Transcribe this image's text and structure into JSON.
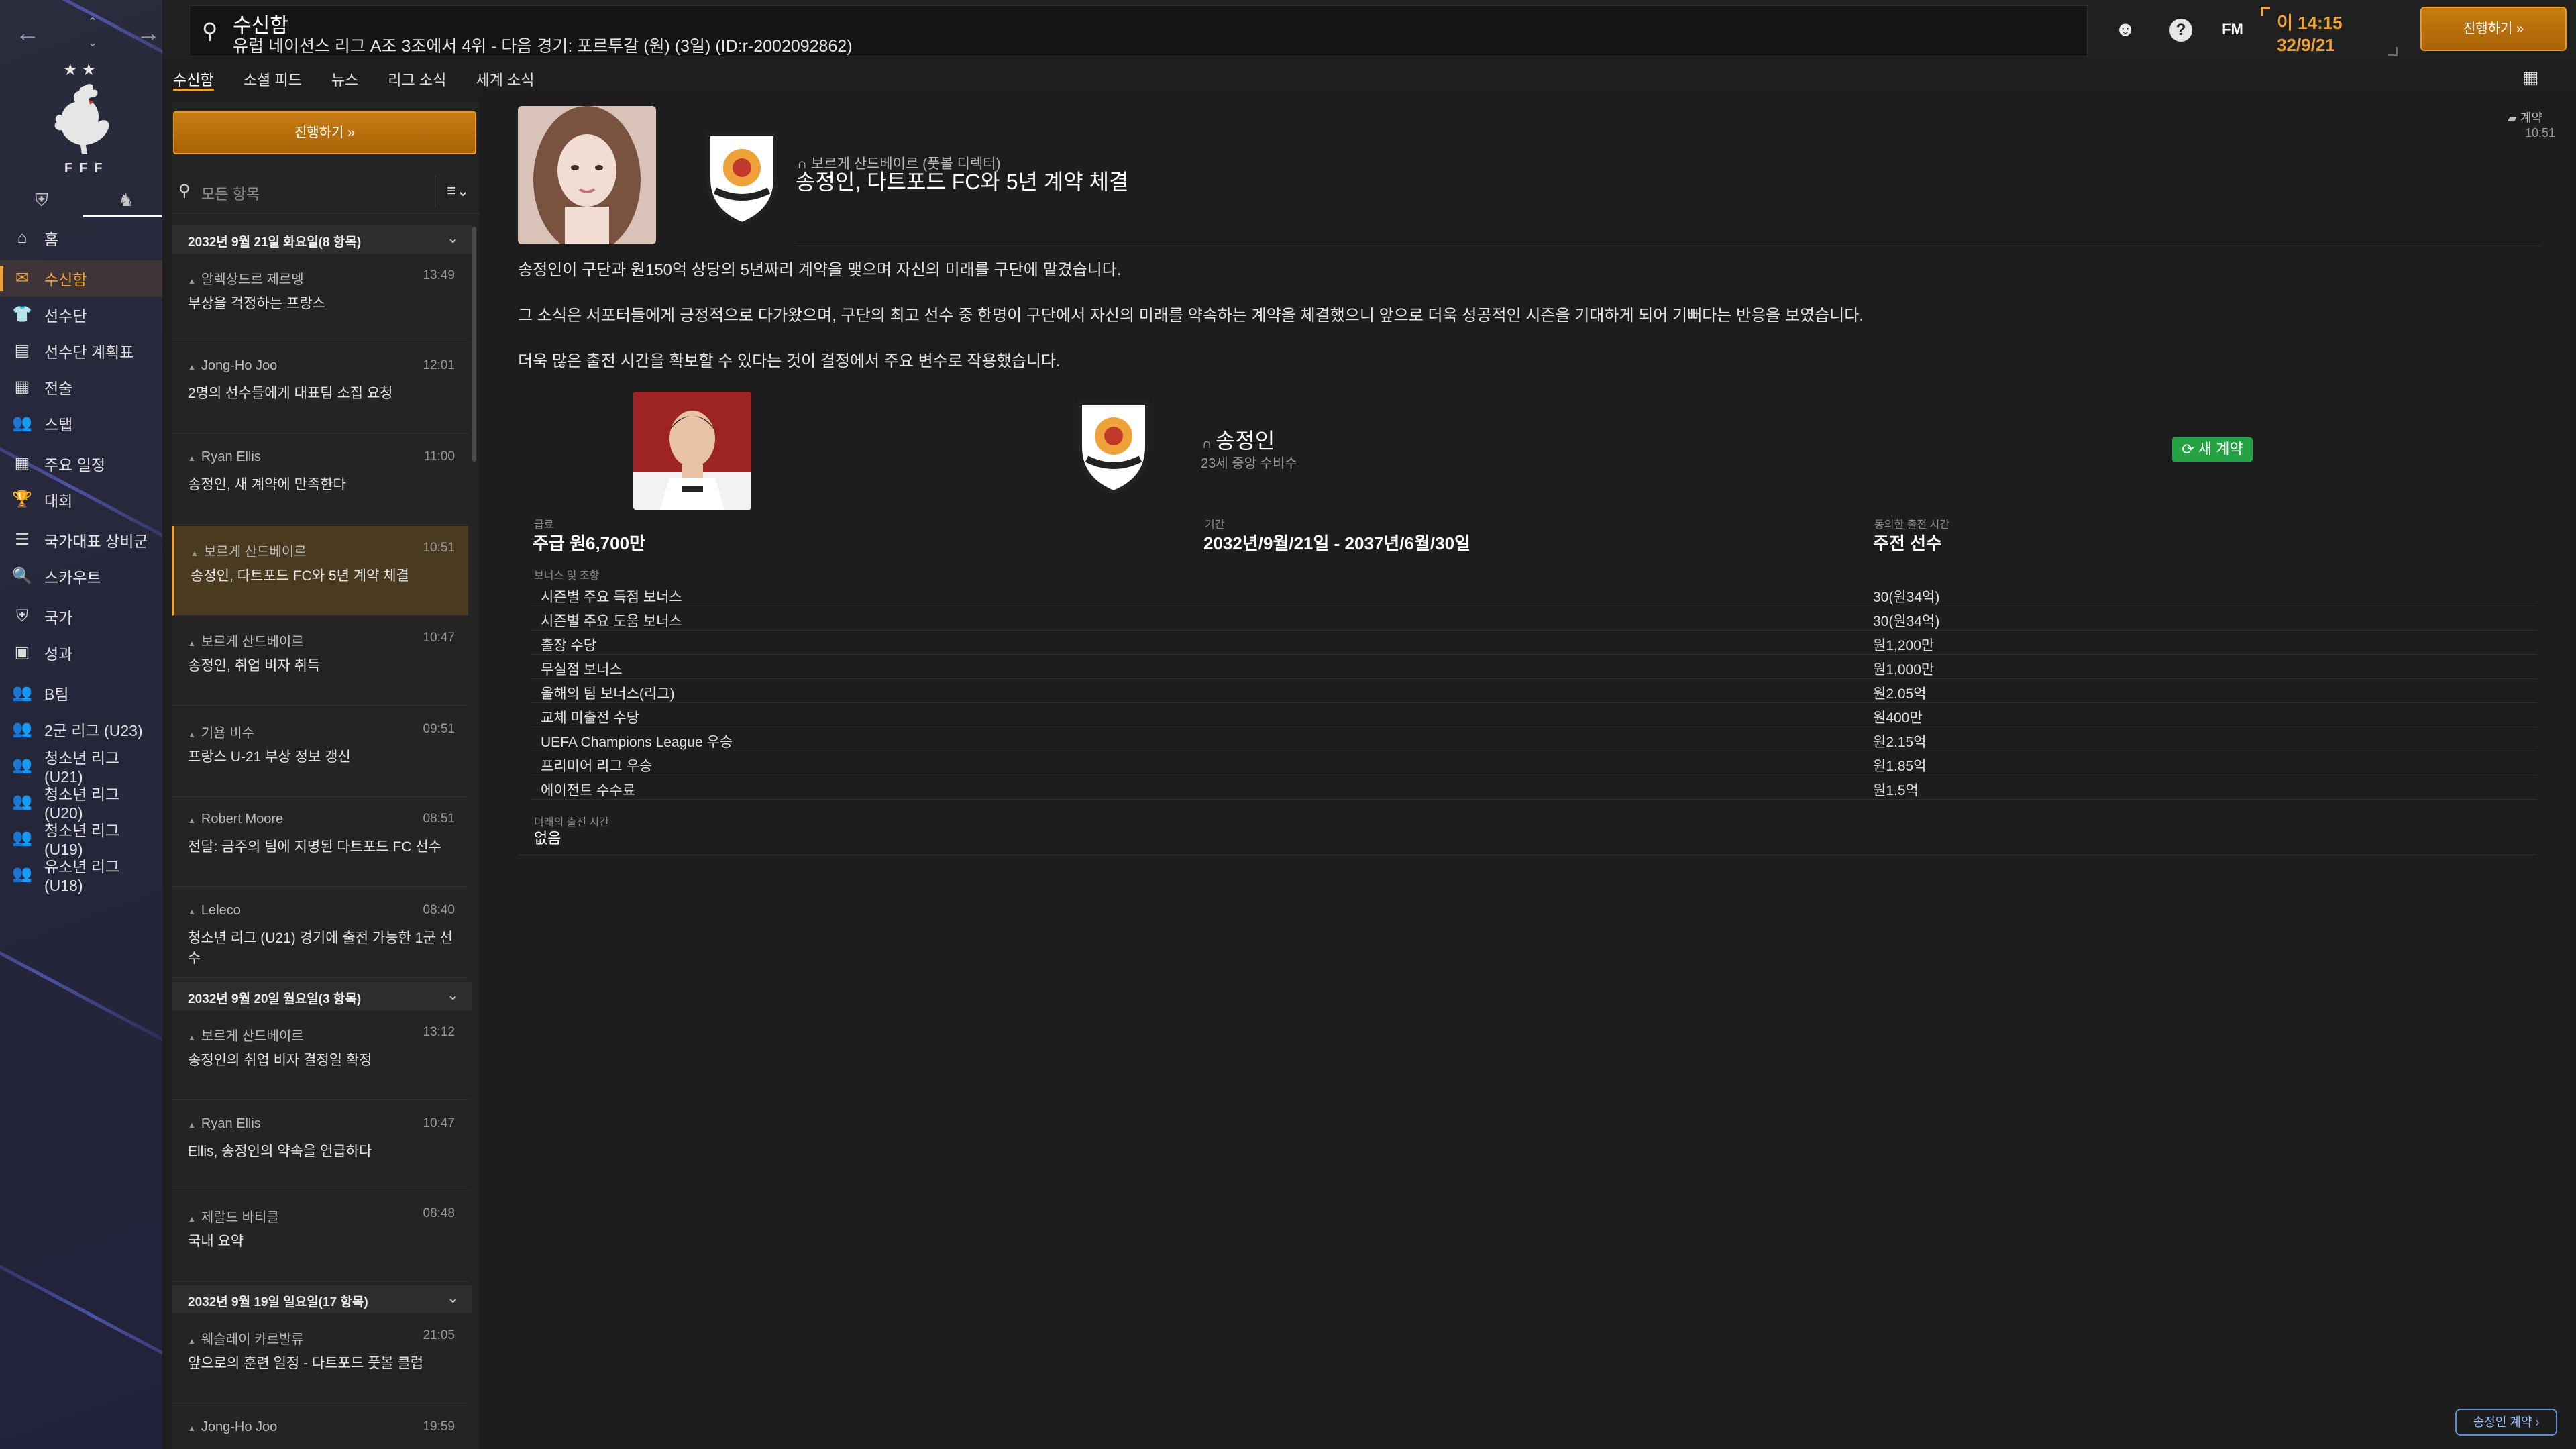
{
  "sidebar": {
    "nav_back": "←",
    "nav_forward": "→",
    "nav_up": "⌃",
    "nav_down": "⌄",
    "crest_stars": "★★",
    "crest_text": "FFF",
    "items": [
      {
        "label": "홈",
        "icon": "home-icon",
        "glyph": "⌂"
      },
      {
        "label": "수신함",
        "icon": "inbox-icon",
        "glyph": "✉",
        "active": true
      },
      {
        "label": "선수단",
        "icon": "squad-icon",
        "glyph": "👕"
      },
      {
        "label": "선수단 계획표",
        "icon": "squad-planner-icon",
        "glyph": "▤"
      },
      {
        "label": "전술",
        "icon": "tactics-icon",
        "glyph": "▦"
      },
      {
        "label": "스탭",
        "icon": "staff-icon",
        "glyph": "👥"
      },
      {
        "label": "주요 일정",
        "icon": "schedule-icon",
        "glyph": "▦"
      },
      {
        "label": "대회",
        "icon": "trophy-icon",
        "glyph": "🏆"
      },
      {
        "label": "국가대표 상비군",
        "icon": "list-icon",
        "glyph": "☰"
      },
      {
        "label": "스카우트",
        "icon": "scout-icon",
        "glyph": "🔍"
      },
      {
        "label": "국가",
        "icon": "shield-icon",
        "glyph": "⛨"
      },
      {
        "label": "성과",
        "icon": "achievements-icon",
        "glyph": "▣"
      },
      {
        "label": "B팀",
        "icon": "team-b-icon",
        "glyph": "👥"
      },
      {
        "label": "2군 리그 (U23)",
        "icon": "team-u23-icon",
        "glyph": "👥"
      },
      {
        "label": "청소년 리그 (U21)",
        "icon": "team-u21-icon",
        "glyph": "👥"
      },
      {
        "label": "청소년 리그 (U20)",
        "icon": "team-u20-icon",
        "glyph": "👥"
      },
      {
        "label": "청소년 리그 (U19)",
        "icon": "team-u19-icon",
        "glyph": "👥"
      },
      {
        "label": "유소년 리그 (U18)",
        "icon": "team-u18-icon",
        "glyph": "👥"
      }
    ]
  },
  "topbar": {
    "title": "수신함",
    "subtitle": "유럽 네이션스 리그 A조 3조에서 4위 - 다음 경기: 포르투갈 (원) (3일) (ID:r-2002092862)",
    "fm_label": "FM",
    "help_label": "?",
    "time": "이 14:15",
    "date": "32/9/21",
    "continue_label": "진행하기 »"
  },
  "tabs": [
    "수신함",
    "소셜 피드",
    "뉴스",
    "리그 소식",
    "세계 소식"
  ],
  "list": {
    "continue_label": "진행하기 »",
    "search_placeholder": "모든 항목",
    "options_glyph": "≡⌄",
    "groups": [
      {
        "header": "2032년 9월 21일 화요일(8 항목)",
        "messages": [
          {
            "sender": "알렉상드르 제르멩",
            "time": "13:49",
            "subject": "부상을 걱정하는 프랑스"
          },
          {
            "sender": "Jong-Ho Joo",
            "time": "12:01",
            "subject": "2명의 선수들에게 대표팀 소집 요청"
          },
          {
            "sender": "Ryan Ellis",
            "time": "11:00",
            "subject": "송정인, 새 계약에 만족한다"
          },
          {
            "sender": "보르게 산드베이르",
            "time": "10:51",
            "subject": "송정인, 다트포드 FC와 5년 계약 체결",
            "selected": true
          },
          {
            "sender": "보르게 산드베이르",
            "time": "10:47",
            "subject": "송정인, 취업 비자 취득"
          },
          {
            "sender": "기욤 비수",
            "time": "09:51",
            "subject": "프랑스 U-21 부상 정보 갱신"
          },
          {
            "sender": "Robert Moore",
            "time": "08:51",
            "subject": "전달: 금주의 팀에 지명된 다트포드 FC 선수"
          },
          {
            "sender": "Leleco",
            "time": "08:40",
            "subject": "청소년 리그 (U21) 경기에 출전 가능한 1군 선수"
          }
        ]
      },
      {
        "header": "2032년 9월 20일 월요일(3 항목)",
        "messages": [
          {
            "sender": "보르게 산드베이르",
            "time": "13:12",
            "subject": "송정인의 취업 비자 결정일 확정"
          },
          {
            "sender": "Ryan Ellis",
            "time": "10:47",
            "subject": "Ellis, 송정인의 약속을 언급하다"
          },
          {
            "sender": "제랄드 바티클",
            "time": "08:48",
            "subject": "국내 요약"
          }
        ]
      },
      {
        "header": "2032년 9월 19일 일요일(17 항목)",
        "messages": [
          {
            "sender": "웨슬레이 카르발류",
            "time": "21:05",
            "subject": "앞으로의 훈련 일정 - 다트포드 풋볼 클럽"
          },
          {
            "sender": "Jong-Ho Joo",
            "time": "19:59",
            "subject": ""
          }
        ]
      }
    ]
  },
  "detail": {
    "sender": "보르게 산드베이르 (풋볼 디렉터)",
    "headline": "송정인, 다트포드 FC와 5년 계약 체결",
    "tag": "계약",
    "tag_time": "10:51",
    "paragraphs": [
      "송정인이 구단과 원150억 상당의 5년짜리 계약을 맺으며 자신의 미래를 구단에 맡겼습니다.",
      "그 소식은 서포터들에게 긍정적으로 다가왔으며, 구단의 최고 선수 중 한명이 구단에서 자신의 미래를 약속하는 계약을 체결했으니 앞으로 더욱 성공적인 시즌을 기대하게 되어 기뻐다는 반응을 보였습니다.",
      "더욱 많은 출전 시간을 확보할 수 있다는 것이 결정에서 주요 변수로 작용했습니다."
    ],
    "player_name": "송정인",
    "player_sub": "23세 중앙 수비수",
    "badge": "새 계약",
    "wage_label": "급료",
    "wage_value": "주급 원6,700만",
    "period_label": "기간",
    "period_value": "2032년/9월/21일 - 2037년/6월/30일",
    "playing_time_label": "동의한 출전 시간",
    "playing_time_value": "주전 선수",
    "bonus_label": "보너스 및 조항",
    "clauses": [
      {
        "name": "시즌별 주요 득점 보너스",
        "value": "30(원34억)"
      },
      {
        "name": "시즌별 주요 도움 보너스",
        "value": "30(원34억)"
      },
      {
        "name": "출장 수당",
        "value": "원1,200만"
      },
      {
        "name": "무실점 보너스",
        "value": "원1,000만"
      },
      {
        "name": "올해의 팀 보너스(리그)",
        "value": "원2.05억"
      },
      {
        "name": "교체 미출전 수당",
        "value": "원400만"
      },
      {
        "name": "UEFA Champions League 우승",
        "value": "원2.15억"
      },
      {
        "name": "프리미어 리그 우승",
        "value": "원1.85억"
      },
      {
        "name": "에이전트 수수료",
        "value": "원1.5억"
      }
    ],
    "future_label": "미래의 출전 시간",
    "future_value": "없음",
    "bottom_link": "송정인 계약 ›"
  },
  "colors": {
    "accent": "#f0a23a",
    "badge_green": "#25a244",
    "button_orange": "#c77d12",
    "link_blue": "#5b8fd8"
  }
}
